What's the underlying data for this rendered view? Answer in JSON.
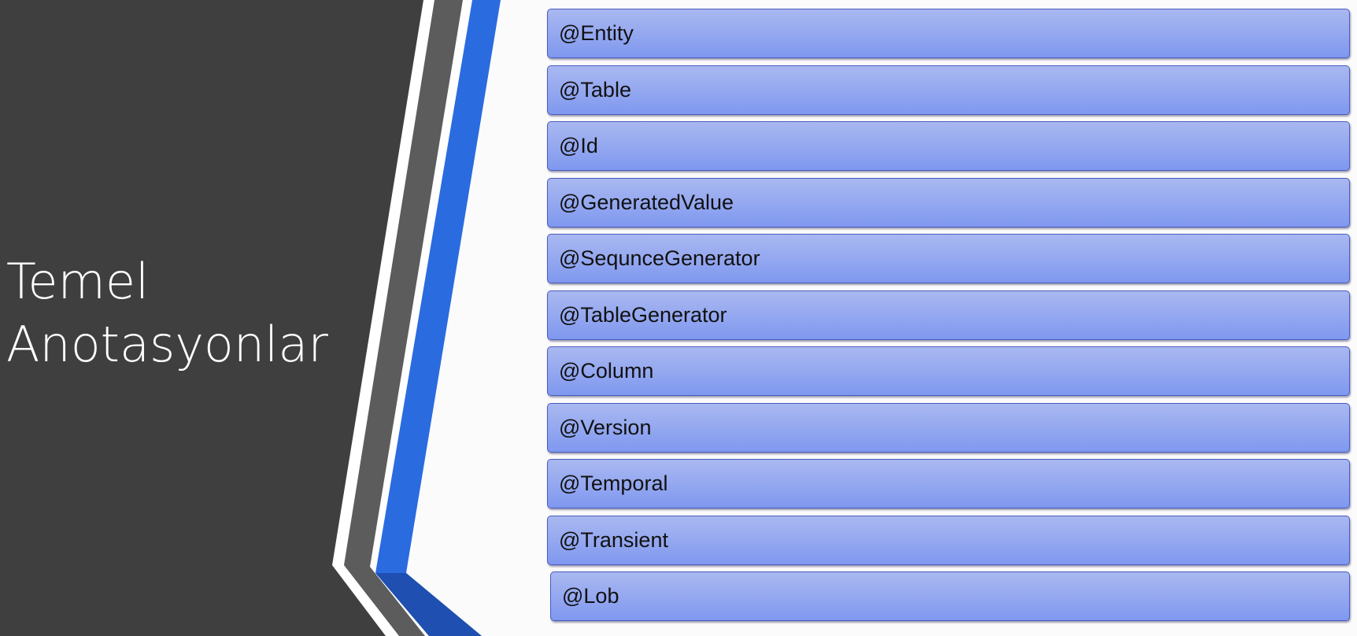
{
  "slide": {
    "title_lines": [
      "Temel",
      "Anotasyonlar"
    ],
    "items": [
      "@Entity",
      "@Table",
      "@Id",
      "@GeneratedValue",
      "@SequnceGenerator",
      "@TableGenerator",
      "@Column",
      "@Version",
      "@Temporal",
      "@Transient",
      "@Lob"
    ]
  },
  "colors": {
    "left_panel": "#3f3f3f",
    "accent_blue": "#2a6be0",
    "item_fill": "#97aaf0",
    "item_border": "#4a5bbf",
    "background": "#fbfbfb"
  }
}
